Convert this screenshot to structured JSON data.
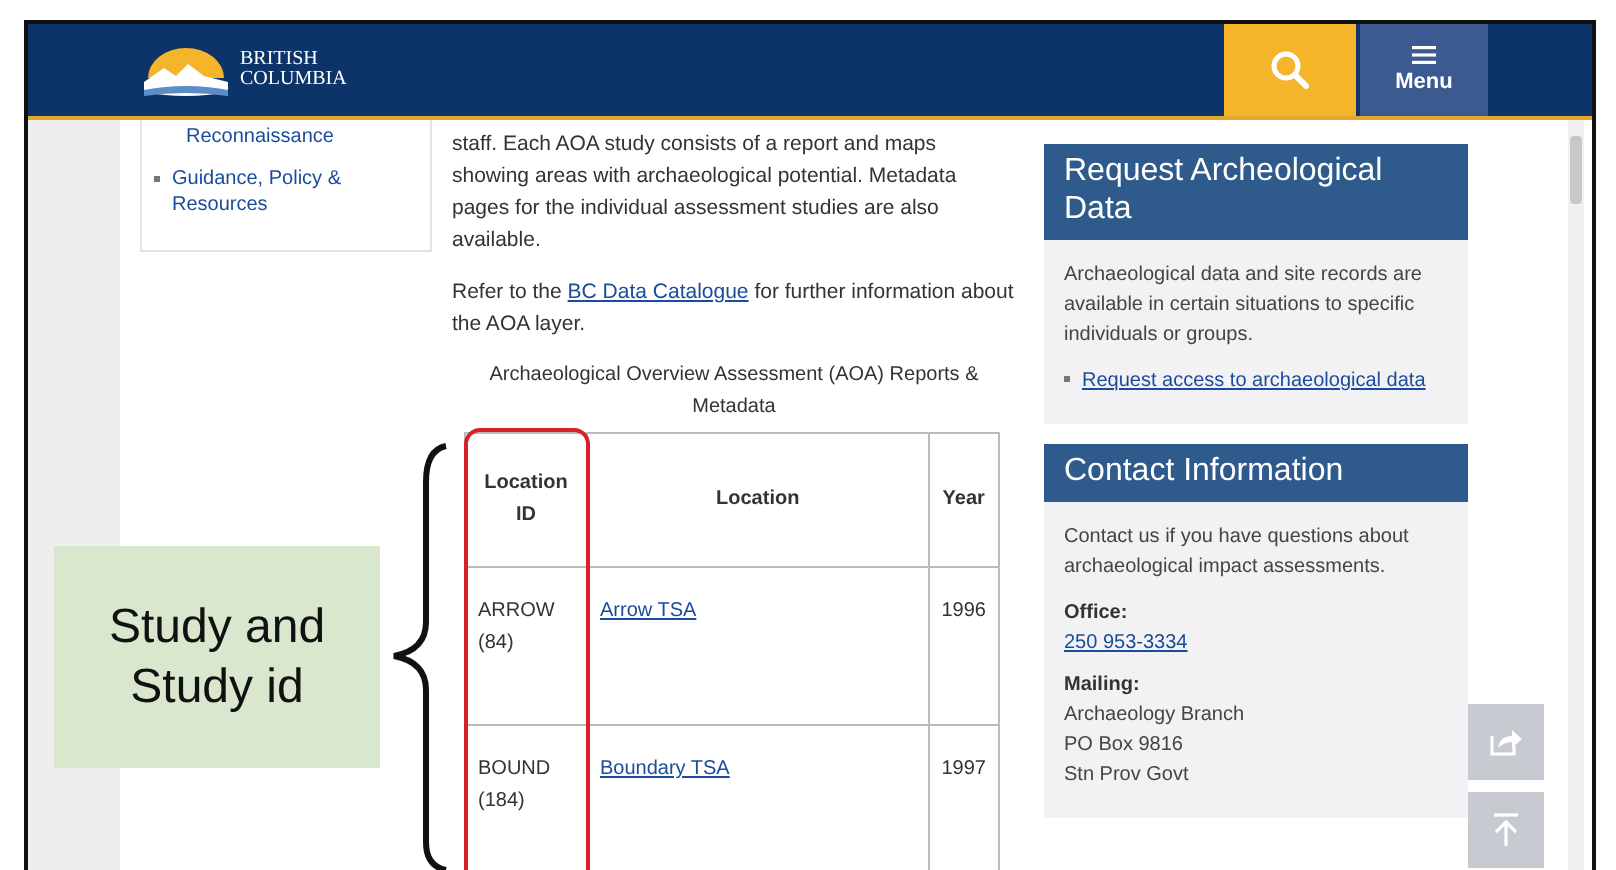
{
  "header": {
    "logo_lines": [
      "BRITISH",
      "COLUMBIA"
    ],
    "menu_label": "Menu"
  },
  "sidebar": {
    "items": [
      {
        "label": "Reconnaissance",
        "kind": "plain"
      },
      {
        "label": "Guidance, Policy & Resources",
        "kind": "bulleted"
      }
    ]
  },
  "main": {
    "intro": "staff. Each AOA study consists of a report and maps showing areas with archaeological potential. Metadata pages for the individual assessment studies are also available.",
    "refer_before": "Refer to the",
    "refer_link": "BC Data Catalogue",
    "refer_after": "for further information about the AOA layer.",
    "table": {
      "caption": "Archaeological Overview Assessment (AOA) Reports & Metadata",
      "columns": [
        "Location ID",
        "Location",
        "Year"
      ],
      "rows": [
        {
          "id": "ARROW (84)",
          "location": "Arrow TSA",
          "year": "1996"
        },
        {
          "id": "BOUND (184)",
          "location": "Boundary TSA",
          "year": "1997"
        }
      ]
    }
  },
  "request_panel": {
    "title": "Request Archeological Data",
    "text": "Archaeological data and site records are available in certain situations to specific individuals or groups.",
    "link": "Request access to archaeological data"
  },
  "contact_panel": {
    "title": "Contact Information",
    "text": "Contact us if you have questions about archaeological impact assessments.",
    "office_label": "Office:",
    "phone": "250 953-3334",
    "mailing_label": "Mailing:",
    "address": [
      "Archaeology Branch",
      "PO Box 9816",
      "Stn Prov Govt"
    ]
  },
  "annotation": {
    "label": "Study and Study id"
  }
}
